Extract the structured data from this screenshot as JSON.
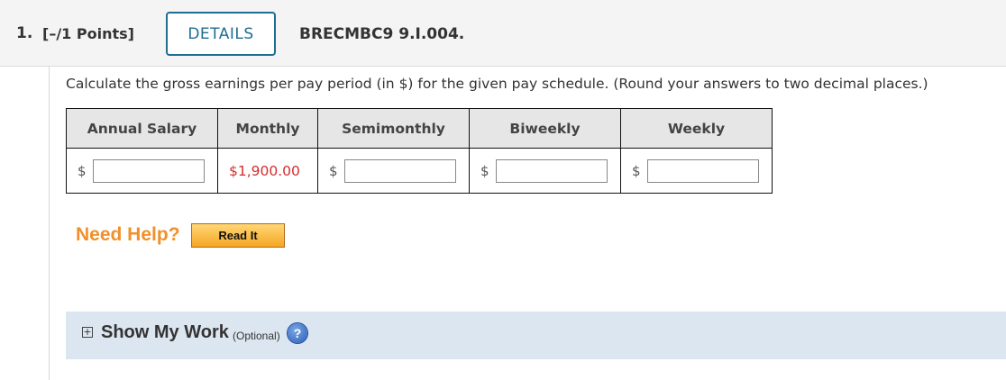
{
  "header": {
    "question_number": "1.",
    "points": "[–/1 Points]",
    "details_label": "DETAILS",
    "question_id": "BRECMBC9 9.I.004."
  },
  "prompt": "Calculate the gross earnings per pay period (in $) for the given pay schedule. (Round your answers to two decimal places.)",
  "table": {
    "columns": [
      "Annual Salary",
      "Monthly",
      "Semimonthly",
      "Biweekly",
      "Weekly"
    ],
    "currency_symbol": "$",
    "annual_salary_value": "",
    "monthly_value": "$1,900.00",
    "semimonthly_value": "",
    "biweekly_value": "",
    "weekly_value": ""
  },
  "help": {
    "need_help_label": "Need Help?",
    "read_it_label": "Read It"
  },
  "show_work": {
    "toggle_icon": "+",
    "title": "Show My Work",
    "optional_label": "(Optional)",
    "help_icon": "?"
  },
  "colors": {
    "accent": "#1f6d91",
    "given_value": "#d52c2c",
    "need_help": "#f0902a",
    "show_work_bg": "#dce6f0"
  }
}
